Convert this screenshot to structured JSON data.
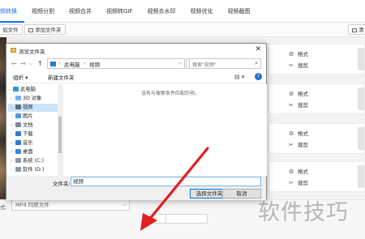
{
  "topnav": {
    "tabs": [
      {
        "label": "频转换",
        "active": true
      },
      {
        "label": "视频分割"
      },
      {
        "label": "视频合并"
      },
      {
        "label": "视频转GIF"
      },
      {
        "label": "视频去水印"
      },
      {
        "label": "视频优化"
      },
      {
        "label": "视频截图"
      }
    ]
  },
  "toolbar": {
    "add_file": "加文件",
    "add_folder": "添加文件夹",
    "clear": "清"
  },
  "video_list": {
    "items": [
      {
        "format_label": "格式",
        "crop_label": "裁剪"
      },
      {
        "format_label": "格式",
        "crop_label": "裁剪"
      },
      {
        "format_label": "格式",
        "crop_label": "裁剪"
      },
      {
        "format_label": "格式",
        "crop_label": "裁剪"
      }
    ]
  },
  "bottom": {
    "format_label": "式:",
    "format_value": "MP4  同原文件"
  },
  "dialog": {
    "title": "浏览文件夹",
    "breadcrumb": [
      "此电脑",
      "视频"
    ],
    "search_placeholder": "搜索\"视频\"",
    "organize": "组织 ▾",
    "new_folder": "新建文件夹",
    "empty_message": "没有与搜索条件匹配的项。",
    "nav_items": [
      {
        "label": "此电脑",
        "icon": "computer-icon",
        "color": "#3a8ee6"
      },
      {
        "label": "3D 对象",
        "icon": "cube-icon",
        "color": "#6fb3f0"
      },
      {
        "label": "视频",
        "icon": "video-folder-icon",
        "color": "#5a6b7d",
        "selected": true
      },
      {
        "label": "图片",
        "icon": "picture-folder-icon",
        "color": "#4f9be0"
      },
      {
        "label": "文档",
        "icon": "document-folder-icon",
        "color": "#7a8a9a"
      },
      {
        "label": "下载",
        "icon": "download-icon",
        "color": "#2e7bd6"
      },
      {
        "label": "音乐",
        "icon": "music-icon",
        "color": "#2a7bd4"
      },
      {
        "label": "桌面",
        "icon": "desktop-icon",
        "color": "#3f86d8"
      },
      {
        "label": "系统 (C:)",
        "icon": "drive-icon",
        "color": "#8c9aa6"
      },
      {
        "label": "软件 (D:)",
        "icon": "drive-icon",
        "color": "#8c9aa6"
      }
    ],
    "filename_label": "文件夹:",
    "filename_value": "视频",
    "select_button": "选择文件夹",
    "cancel_button": "取消"
  },
  "watermark": "软件技巧",
  "colors": {
    "accent": "#1a73e8",
    "arrow": "#e02020",
    "selection": "#cce4f7"
  }
}
